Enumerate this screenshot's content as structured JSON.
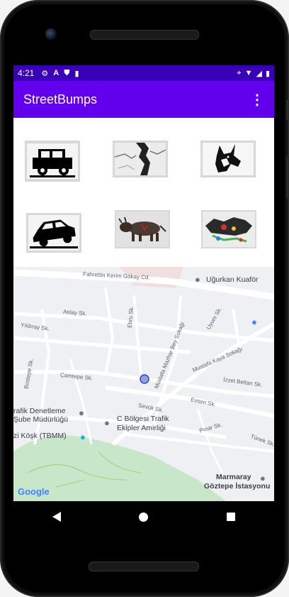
{
  "status_bar": {
    "time": "4:21",
    "left_icons": [
      "settings-icon",
      "a-icon",
      "shield-icon",
      "sd-card-icon"
    ],
    "right_icons": [
      "location-icon",
      "wifi-icon",
      "signal-icon",
      "battery-icon"
    ]
  },
  "app_bar": {
    "title": "StreetBumps",
    "menu_icon": "overflow-menu-icon"
  },
  "image_buttons": [
    {
      "name": "car-bump-button",
      "icon": "car"
    },
    {
      "name": "crack-button",
      "icon": "crack"
    },
    {
      "name": "dog-button",
      "icon": "dog"
    },
    {
      "name": "car-tilted-button",
      "icon": "car-tilted"
    },
    {
      "name": "animal-button",
      "icon": "animal"
    },
    {
      "name": "trash-button",
      "icon": "trash"
    }
  ],
  "map": {
    "labels": {
      "street_1": "Fahrettin Kerim Gökay Cd.",
      "street_2": "Atılay Sk.",
      "street_3": "Ebru Sk.",
      "street_4": "Yıldıray Sk.",
      "street_5": "Mustafa Mazhar Bey Sokağı",
      "street_6": "Uyum Sk.",
      "street_7": "Bostepe Sk.",
      "street_8": "Çamtepe Sk.",
      "street_9": "Mustafa Kaya Sokağı",
      "street_10": "İzzet Beltan Sk.",
      "street_11": "Evsen Sk.",
      "street_12": "Sevük Sk.",
      "street_13": "Pınar Sk.",
      "street_14": "Tünek Sk."
    },
    "pois": {
      "poi_1": "Uğurkan Kuaför",
      "poi_2_line1": "rafik Denetleme",
      "poi_2_line2": "Şube Müdürlüğü",
      "poi_3_line1": "C Bölgesi Trafik",
      "poi_3_line2": "Ekipler Amirliği",
      "poi_4": "zi Köşk (TBMM)",
      "poi_5_line1": "Marmaray",
      "poi_5_line2": "Göztepe İstasyonu"
    },
    "attribution": "Google",
    "colors": {
      "road": "#ffffff",
      "background": "#eef0f3",
      "park": "#c8e6c9",
      "poi_pin": "#70757a",
      "location_dot": "#8ea0ea"
    }
  },
  "nav_bar": {
    "buttons": [
      "back-button",
      "home-button",
      "recents-button"
    ]
  }
}
